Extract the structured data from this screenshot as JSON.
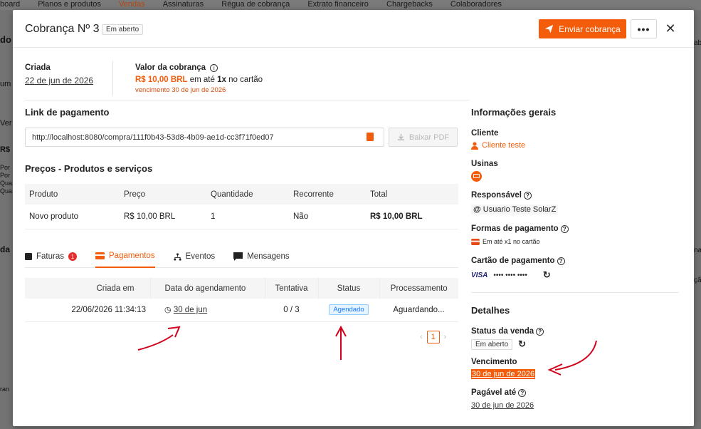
{
  "bg": {
    "nav_items": [
      "board",
      "Planos e produtos",
      "Vendas",
      "Assinaturas",
      "Régua de cobrança",
      "Extrato financeiro",
      "Chargebacks",
      "Colaboradores"
    ],
    "left_texts": [
      "do",
      "um",
      "Ver",
      "R$",
      "Por",
      "Por",
      "Qua",
      "Qua",
      "da",
      "ran"
    ],
    "right_texts": [
      "ab",
      "na",
      "ção"
    ]
  },
  "modal": {
    "title": "Cobrança Nº 3",
    "status_tag": "Em aberto",
    "send_button": "Enviar cobrança",
    "more_button": "•••",
    "close_button": "✕"
  },
  "summary": {
    "created_label": "Criada",
    "created_date": "22 de jun de 2026",
    "value_label": "Valor da cobrança",
    "value_amount": "R$ 10,00 BRL",
    "value_mid": "em até",
    "value_times": "1x",
    "value_method": "no cartão",
    "value_due": "vencimento 30 de jun de 2026"
  },
  "payment_link": {
    "title": "Link de pagamento",
    "url": "http://localhost:8080/compra/111f0b43-53d8-4b09-ae1d-cc3f71f0ed07",
    "pdf_button": "Baixar PDF"
  },
  "prices": {
    "title": "Preços - Produtos e serviços",
    "columns": [
      "Produto",
      "Preço",
      "Quantidade",
      "Recorrente",
      "Total"
    ],
    "rows": [
      [
        "Novo produto",
        "R$ 10,00 BRL",
        "1",
        "Não",
        "R$ 10,00 BRL"
      ]
    ]
  },
  "tabs": [
    {
      "label": "Faturas",
      "badge": "1"
    },
    {
      "label": "Pagamentos"
    },
    {
      "label": "Eventos"
    },
    {
      "label": "Mensagens"
    }
  ],
  "attempts": {
    "columns": [
      "Criada em",
      "Data do agendamento",
      "Tentativa",
      "Status",
      "Processamento"
    ],
    "rows": [
      {
        "created": "22/06/2026 11:34:13",
        "scheduled": "30 de jun",
        "attempt": "0 / 3",
        "status": "Agendado",
        "processing": "Aguardando..."
      }
    ],
    "page": "1"
  },
  "general": {
    "title": "Informações gerais",
    "client_label": "Cliente",
    "client_value": "Cliente teste",
    "plants_label": "Usinas",
    "responsible_label": "Responsável",
    "responsible_value": "Usuario Teste SolarZ",
    "payment_forms_label": "Formas de pagamento",
    "payment_forms_value": "Em até x1 no cartão",
    "card_label": "Cartão de pagamento",
    "card_brand": "VISA",
    "card_number": "•••• •••• ••••"
  },
  "details": {
    "title": "Detalhes",
    "sale_status_label": "Status da venda",
    "sale_status_value": "Em aberto",
    "due_label": "Vencimento",
    "due_value": "30 de jun de 2026",
    "payable_label": "Pagável até",
    "payable_value": "30 de jun de 2026"
  },
  "colors": {
    "accent": "#f25c0a",
    "annotation": "#d0021b",
    "status_blue": "#1677ff"
  }
}
